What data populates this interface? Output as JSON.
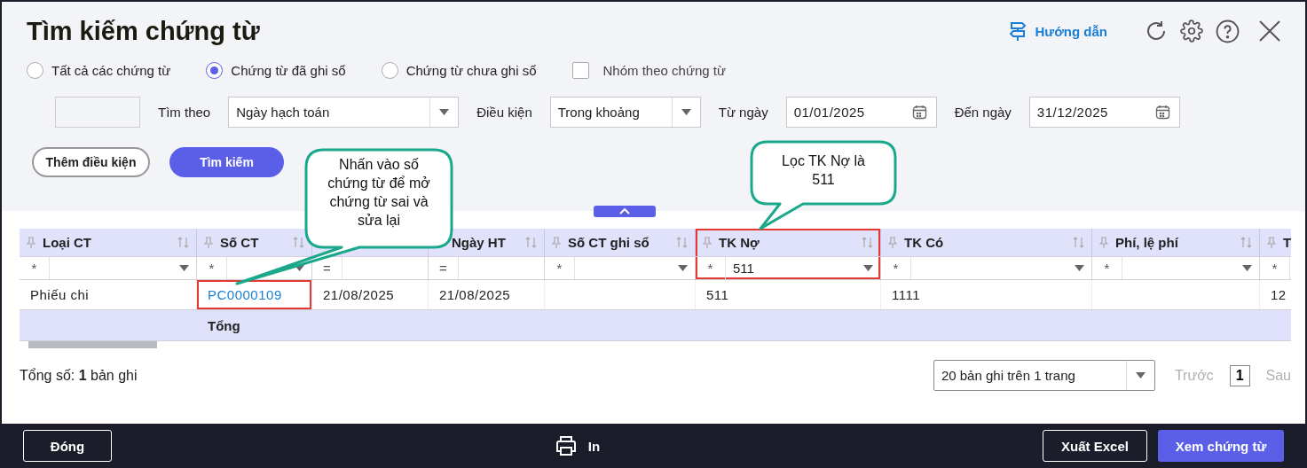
{
  "title": "Tìm kiếm chứng từ",
  "guide": {
    "label": "Hướng dẫn"
  },
  "scope_options": [
    {
      "label": "Tất cả các chứng từ",
      "selected": false
    },
    {
      "label": "Chứng từ đã ghi sổ",
      "selected": true
    },
    {
      "label": "Chứng từ chưa ghi sổ",
      "selected": false
    }
  ],
  "group_by_voucher": {
    "label": "Nhóm theo chứng từ",
    "checked": false
  },
  "criteria": [
    {
      "kind": "select",
      "label": "Tìm theo",
      "value": "Ngày hạch toán"
    },
    {
      "kind": "select",
      "label": "Điều kiện",
      "value": "Trong khoảng"
    },
    {
      "kind": "date",
      "label": "Từ ngày",
      "value": "01/01/2025"
    },
    {
      "kind": "date",
      "label": "Đến ngày",
      "value": "31/12/2025"
    }
  ],
  "actions": [
    {
      "kind": "outline",
      "label": "Thêm điều kiện"
    },
    {
      "kind": "primary",
      "label": "Tìm kiếm"
    }
  ],
  "table": {
    "columns": [
      {
        "label": "Loại CT",
        "highlighted": false,
        "filter": {
          "kind": "text",
          "op": "*"
        }
      },
      {
        "label": "Số CT",
        "highlighted": false,
        "filter": {
          "kind": "text",
          "op": "*"
        }
      },
      {
        "highlighted": false,
        "filter": {
          "kind": "date",
          "op": "="
        }
      },
      {
        "label": "Ngày HT",
        "highlighted": false,
        "filter": {
          "kind": "date",
          "op": "="
        }
      },
      {
        "label": "Số CT ghi sổ",
        "highlighted": false,
        "filter": {
          "kind": "text",
          "op": "*"
        }
      },
      {
        "label": "TK Nợ",
        "highlighted": true,
        "filter": {
          "kind": "text",
          "op": "*",
          "value": "511"
        }
      },
      {
        "label": "TK Có",
        "highlighted": false,
        "filter": {
          "kind": "text",
          "op": "*"
        }
      },
      {
        "label": "Phí, lệ phí",
        "highlighted": false,
        "filter": {
          "kind": "text",
          "op": "*"
        }
      },
      {
        "label": "T",
        "highlighted": false,
        "clipped": true,
        "filter": {
          "kind": "text",
          "op": "*"
        }
      }
    ],
    "rows": [
      {
        "cells": [
          {
            "text": "Phiếu chi",
            "kind": "text",
            "highlighted": false
          },
          {
            "text": "PC0000109",
            "kind": "link",
            "highlighted": true
          },
          {
            "text": "21/08/2025",
            "kind": "text",
            "highlighted": false
          },
          {
            "text": "21/08/2025",
            "kind": "text",
            "highlighted": false
          },
          {
            "kind": "text",
            "highlighted": false
          },
          {
            "text": "511",
            "kind": "text",
            "highlighted": false
          },
          {
            "text": "1111",
            "kind": "text",
            "highlighted": false
          },
          {
            "kind": "text",
            "highlighted": false
          },
          {
            "text": "12",
            "kind": "text",
            "highlighted": false
          }
        ]
      }
    ],
    "total_label": "Tổng"
  },
  "record_count": "Tổng số: **1** bản ghi",
  "pager": {
    "page_size": "20 bản ghi trên 1 trang",
    "prev": {
      "label": "Trước",
      "disabled": true
    },
    "pages": [
      {
        "label": "1",
        "selected": true
      }
    ],
    "next": {
      "label": "Sau",
      "disabled": true
    }
  },
  "annotations": [
    {
      "kind": "callout",
      "text": "Nhấn vào số chứng từ để mở chứng từ sai và sửa lại"
    },
    {
      "kind": "callout",
      "text": "Lọc TK Nợ là 511"
    }
  ],
  "footer": {
    "close": "Đóng",
    "print": "In",
    "export": "Xuất Excel",
    "view": "Xem chứng từ"
  }
}
